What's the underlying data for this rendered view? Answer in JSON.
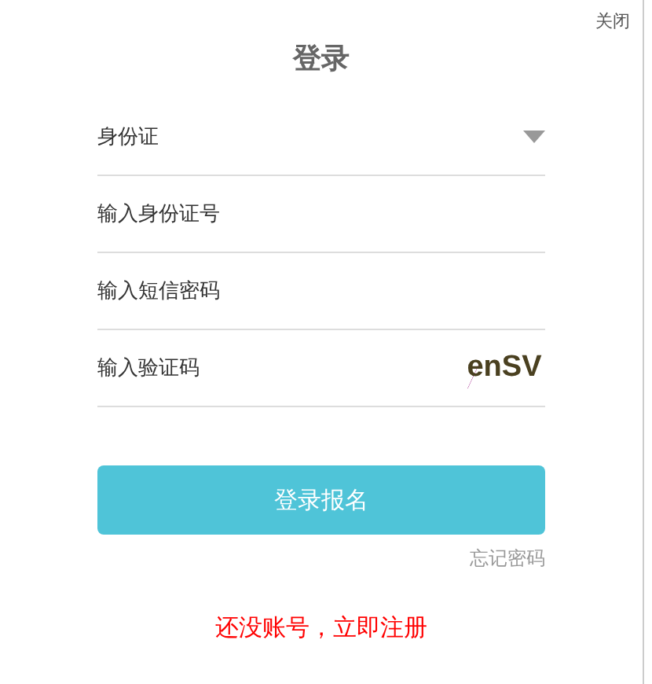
{
  "close": "关闭",
  "title": "登录",
  "id_type": {
    "value": "身份证"
  },
  "fields": [
    {
      "kind": "text",
      "placeholder": "输入身份证号"
    },
    {
      "kind": "text",
      "placeholder": "输入短信密码"
    },
    {
      "kind": "captcha",
      "placeholder": "输入验证码",
      "captcha": "enSV"
    }
  ],
  "submit": "登录报名",
  "forgot": "忘记密码",
  "register": "还没账号，立即注册"
}
